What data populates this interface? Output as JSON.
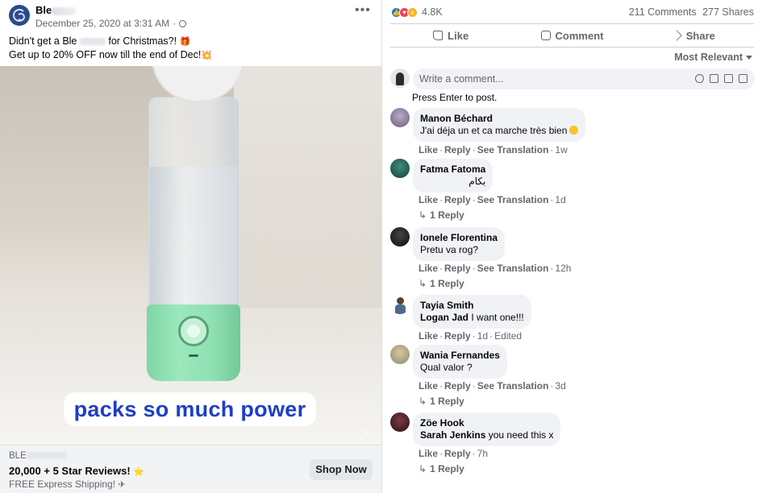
{
  "post": {
    "page_name": "Ble",
    "date": "December 25, 2020 at 3:31 AM",
    "text_line1_a": "Didn't get a Ble",
    "text_line1_b": "for Christmas?!",
    "text_line2": "Get up to 20% OFF now till the end of Dec!",
    "media_caption": "packs so much power",
    "blender_brand": "blender",
    "ad": {
      "domain": "BLE",
      "headline": "20,000 + 5 Star Reviews!",
      "description": "FREE Express Shipping!",
      "cta": "Shop Now"
    }
  },
  "engagement": {
    "reaction_count": "4.8K",
    "comments": "211 Comments",
    "shares": "277 Shares",
    "reactions": [
      "like-icon",
      "love-icon",
      "wow-icon"
    ],
    "actions": [
      "Like",
      "Comment",
      "Share"
    ],
    "sort_label": "Most Relevant"
  },
  "composer": {
    "placeholder": "Write a comment...",
    "hint": "Press Enter to post."
  },
  "comments": [
    {
      "name": "Manon Béchard",
      "text": "J'ai déja un et ca marche très bien",
      "links": [
        "Like",
        "Reply",
        "See Translation"
      ],
      "time": "1w",
      "replies": ""
    },
    {
      "name": "Fatma Fatoma",
      "text": "بكام",
      "links": [
        "Like",
        "Reply",
        "See Translation"
      ],
      "time": "1d",
      "replies": "1 Reply"
    },
    {
      "name": "Ionele Florentina",
      "text": "Pretu va rog?",
      "links": [
        "Like",
        "Reply",
        "See Translation"
      ],
      "time": "12h",
      "replies": "1 Reply"
    },
    {
      "name": "Tayia Smith",
      "mention": "Logan Jad",
      "text": "I want one!!!",
      "links": [
        "Like",
        "Reply"
      ],
      "time": "1d",
      "edited": "Edited",
      "replies": ""
    },
    {
      "name": "Wania Fernandes",
      "text": "Qual valor ?",
      "links": [
        "Like",
        "Reply",
        "See Translation"
      ],
      "time": "3d",
      "replies": "1 Reply"
    },
    {
      "name": "Zöe Hook",
      "mention": "Sarah Jenkins",
      "text": "you need this x",
      "links": [
        "Like",
        "Reply"
      ],
      "time": "7h",
      "replies": "1 Reply"
    }
  ],
  "colors": {
    "accent_blue": "#1877f2",
    "caption_text": "#1e3ec8",
    "blender_green": "#8fe0b2",
    "muted_text": "#65676b"
  }
}
